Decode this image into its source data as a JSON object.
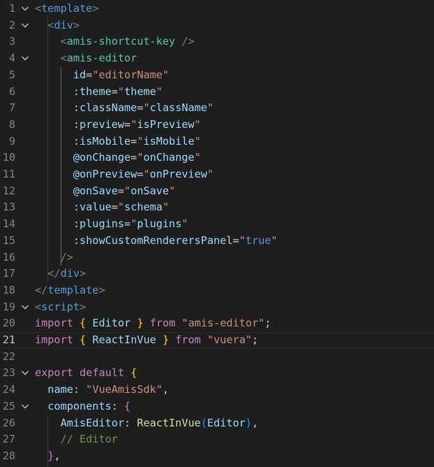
{
  "editor": {
    "language": "vue",
    "current_line": 21,
    "fold_icon": "chevron-down-icon",
    "colors": {
      "background": "#1e1e1e",
      "tag": "#569cd6",
      "punctuation": "#808080",
      "component": "#4ec9b0",
      "attribute": "#9cdcfe",
      "string": "#ce9178",
      "keyword": "#c586c0",
      "bracket": "#ffd700",
      "function": "#dcdcaa",
      "comment": "#6a9955"
    },
    "lines": [
      {
        "n": "1",
        "fold": true,
        "tokens": [
          [
            "t-punc",
            "<"
          ],
          [
            "t-tag",
            "template"
          ],
          [
            "t-punc",
            ">"
          ]
        ]
      },
      {
        "n": "2",
        "fold": true,
        "tokens": [
          [
            "t-txt",
            "  "
          ],
          [
            "t-punc",
            "<"
          ],
          [
            "t-tag",
            "div"
          ],
          [
            "t-punc",
            ">"
          ]
        ]
      },
      {
        "n": "3",
        "fold": false,
        "tokens": [
          [
            "t-txt",
            "    "
          ],
          [
            "t-punc",
            "<"
          ],
          [
            "t-comp",
            "amis-shortcut-key"
          ],
          [
            "t-txt",
            " "
          ],
          [
            "t-punc",
            "/>"
          ]
        ]
      },
      {
        "n": "4",
        "fold": true,
        "tokens": [
          [
            "t-txt",
            "    "
          ],
          [
            "t-punc",
            "<"
          ],
          [
            "t-comp",
            "amis-editor"
          ]
        ]
      },
      {
        "n": "5",
        "fold": false,
        "tokens": [
          [
            "t-txt",
            "      "
          ],
          [
            "t-attr",
            "id"
          ],
          [
            "t-txt",
            "="
          ],
          [
            "t-str",
            "\"editorName\""
          ]
        ]
      },
      {
        "n": "6",
        "fold": false,
        "tokens": [
          [
            "t-txt",
            "      "
          ],
          [
            "t-attr",
            ":theme"
          ],
          [
            "t-txt",
            "="
          ],
          [
            "t-str",
            "\""
          ],
          [
            "t-attr",
            "theme"
          ],
          [
            "t-str",
            "\""
          ]
        ]
      },
      {
        "n": "7",
        "fold": false,
        "tokens": [
          [
            "t-txt",
            "      "
          ],
          [
            "t-attr",
            ":className"
          ],
          [
            "t-txt",
            "="
          ],
          [
            "t-str",
            "\""
          ],
          [
            "t-attr",
            "className"
          ],
          [
            "t-str",
            "\""
          ]
        ]
      },
      {
        "n": "8",
        "fold": false,
        "tokens": [
          [
            "t-txt",
            "      "
          ],
          [
            "t-attr",
            ":preview"
          ],
          [
            "t-txt",
            "="
          ],
          [
            "t-str",
            "\""
          ],
          [
            "t-attr",
            "isPreview"
          ],
          [
            "t-str",
            "\""
          ]
        ]
      },
      {
        "n": "9",
        "fold": false,
        "tokens": [
          [
            "t-txt",
            "      "
          ],
          [
            "t-attr",
            ":isMobile"
          ],
          [
            "t-txt",
            "="
          ],
          [
            "t-str",
            "\""
          ],
          [
            "t-attr",
            "isMobile"
          ],
          [
            "t-str",
            "\""
          ]
        ]
      },
      {
        "n": "10",
        "fold": false,
        "tokens": [
          [
            "t-txt",
            "      "
          ],
          [
            "t-attr",
            "@onChange"
          ],
          [
            "t-txt",
            "="
          ],
          [
            "t-str",
            "\""
          ],
          [
            "t-attr",
            "onChange"
          ],
          [
            "t-str",
            "\""
          ]
        ]
      },
      {
        "n": "11",
        "fold": false,
        "tokens": [
          [
            "t-txt",
            "      "
          ],
          [
            "t-attr",
            "@onPreview"
          ],
          [
            "t-txt",
            "="
          ],
          [
            "t-str",
            "\""
          ],
          [
            "t-attr",
            "onPreview"
          ],
          [
            "t-str",
            "\""
          ]
        ]
      },
      {
        "n": "12",
        "fold": false,
        "tokens": [
          [
            "t-txt",
            "      "
          ],
          [
            "t-attr",
            "@onSave"
          ],
          [
            "t-txt",
            "="
          ],
          [
            "t-str",
            "\""
          ],
          [
            "t-attr",
            "onSave"
          ],
          [
            "t-str",
            "\""
          ]
        ]
      },
      {
        "n": "13",
        "fold": false,
        "tokens": [
          [
            "t-txt",
            "      "
          ],
          [
            "t-attr",
            ":value"
          ],
          [
            "t-txt",
            "="
          ],
          [
            "t-str",
            "\""
          ],
          [
            "t-attr",
            "schema"
          ],
          [
            "t-str",
            "\""
          ]
        ]
      },
      {
        "n": "14",
        "fold": false,
        "tokens": [
          [
            "t-txt",
            "      "
          ],
          [
            "t-attr",
            ":plugins"
          ],
          [
            "t-txt",
            "="
          ],
          [
            "t-str",
            "\""
          ],
          [
            "t-attr",
            "plugins"
          ],
          [
            "t-str",
            "\""
          ]
        ]
      },
      {
        "n": "15",
        "fold": false,
        "tokens": [
          [
            "t-txt",
            "      "
          ],
          [
            "t-attr",
            ":showCustomRenderersPanel"
          ],
          [
            "t-txt",
            "="
          ],
          [
            "t-str",
            "\""
          ],
          [
            "t-kwb",
            "true"
          ],
          [
            "t-str",
            "\""
          ]
        ]
      },
      {
        "n": "16",
        "fold": false,
        "tokens": [
          [
            "t-txt",
            "    "
          ],
          [
            "t-punc",
            "/>"
          ]
        ]
      },
      {
        "n": "17",
        "fold": false,
        "tokens": [
          [
            "t-txt",
            "  "
          ],
          [
            "t-punc",
            "</"
          ],
          [
            "t-tag",
            "div"
          ],
          [
            "t-punc",
            ">"
          ]
        ]
      },
      {
        "n": "18",
        "fold": false,
        "tokens": [
          [
            "t-punc",
            "</"
          ],
          [
            "t-tag",
            "template"
          ],
          [
            "t-punc",
            ">"
          ]
        ]
      },
      {
        "n": "19",
        "fold": true,
        "tokens": [
          [
            "t-punc",
            "<"
          ],
          [
            "t-tag",
            "script"
          ],
          [
            "t-punc",
            ">"
          ]
        ]
      },
      {
        "n": "20",
        "fold": false,
        "tokens": [
          [
            "t-kw",
            "import"
          ],
          [
            "t-txt",
            " "
          ],
          [
            "t-br",
            "{"
          ],
          [
            "t-txt",
            " "
          ],
          [
            "t-attr",
            "Editor"
          ],
          [
            "t-txt",
            " "
          ],
          [
            "t-br",
            "}"
          ],
          [
            "t-txt",
            " "
          ],
          [
            "t-kw",
            "from"
          ],
          [
            "t-txt",
            " "
          ],
          [
            "t-str",
            "\"amis-editor\""
          ],
          [
            "t-txt",
            ";"
          ]
        ]
      },
      {
        "n": "21",
        "fold": false,
        "tokens": [
          [
            "t-kw",
            "import"
          ],
          [
            "t-txt",
            " "
          ],
          [
            "t-br",
            "{"
          ],
          [
            "t-txt",
            " "
          ],
          [
            "t-attr",
            "ReactInVue"
          ],
          [
            "t-txt",
            " "
          ],
          [
            "t-br",
            "}"
          ],
          [
            "t-txt",
            " "
          ],
          [
            "t-kw",
            "from"
          ],
          [
            "t-txt",
            " "
          ],
          [
            "t-str",
            "\"vuera\""
          ],
          [
            "t-txt",
            ";"
          ]
        ]
      },
      {
        "n": "22",
        "fold": false,
        "tokens": []
      },
      {
        "n": "23",
        "fold": true,
        "tokens": [
          [
            "t-kw",
            "export"
          ],
          [
            "t-txt",
            " "
          ],
          [
            "t-kw",
            "default"
          ],
          [
            "t-txt",
            " "
          ],
          [
            "t-br",
            "{"
          ]
        ]
      },
      {
        "n": "24",
        "fold": false,
        "tokens": [
          [
            "t-txt",
            "  "
          ],
          [
            "t-attr",
            "name"
          ],
          [
            "t-txt",
            ": "
          ],
          [
            "t-str",
            "\"VueAmisSdk\""
          ],
          [
            "t-txt",
            ","
          ]
        ]
      },
      {
        "n": "25",
        "fold": true,
        "tokens": [
          [
            "t-txt",
            "  "
          ],
          [
            "t-attr",
            "components"
          ],
          [
            "t-txt",
            ": "
          ],
          [
            "t-br2",
            "{"
          ]
        ]
      },
      {
        "n": "26",
        "fold": false,
        "tokens": [
          [
            "t-txt",
            "    "
          ],
          [
            "t-attr",
            "AmisEditor"
          ],
          [
            "t-txt",
            ": "
          ],
          [
            "t-fn",
            "ReactInVue"
          ],
          [
            "t-br3",
            "("
          ],
          [
            "t-attr",
            "Editor"
          ],
          [
            "t-br3",
            ")"
          ],
          [
            "t-txt",
            ","
          ]
        ]
      },
      {
        "n": "27",
        "fold": false,
        "tokens": [
          [
            "t-txt",
            "    "
          ],
          [
            "t-com",
            "// Editor"
          ]
        ]
      },
      {
        "n": "28",
        "fold": false,
        "tokens": [
          [
            "t-txt",
            "  "
          ],
          [
            "t-br2",
            "}"
          ],
          [
            "t-txt",
            ","
          ]
        ]
      }
    ]
  }
}
